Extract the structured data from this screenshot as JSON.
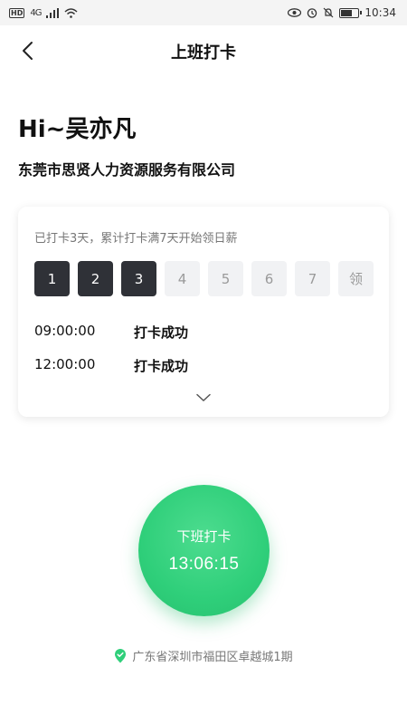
{
  "status_bar": {
    "network": "4G",
    "time": "10:34"
  },
  "header": {
    "title": "上班打卡"
  },
  "greeting": "Hi~吴亦凡",
  "company": "东莞市思贤人力资源服务有限公司",
  "card": {
    "tip": "已打卡3天，累计打卡满7天开始领日薪",
    "days": [
      "1",
      "2",
      "3",
      "4",
      "5",
      "6",
      "7",
      "领"
    ],
    "records": [
      {
        "time": "09:00:00",
        "status": "打卡成功"
      },
      {
        "time": "12:00:00",
        "status": "打卡成功"
      }
    ]
  },
  "punch": {
    "label": "下班打卡",
    "time": "13:06:15"
  },
  "location": "广东省深圳市福田区卓越城1期",
  "colors": {
    "accent": "#2fcf7a",
    "done_day": "#2f3137"
  }
}
